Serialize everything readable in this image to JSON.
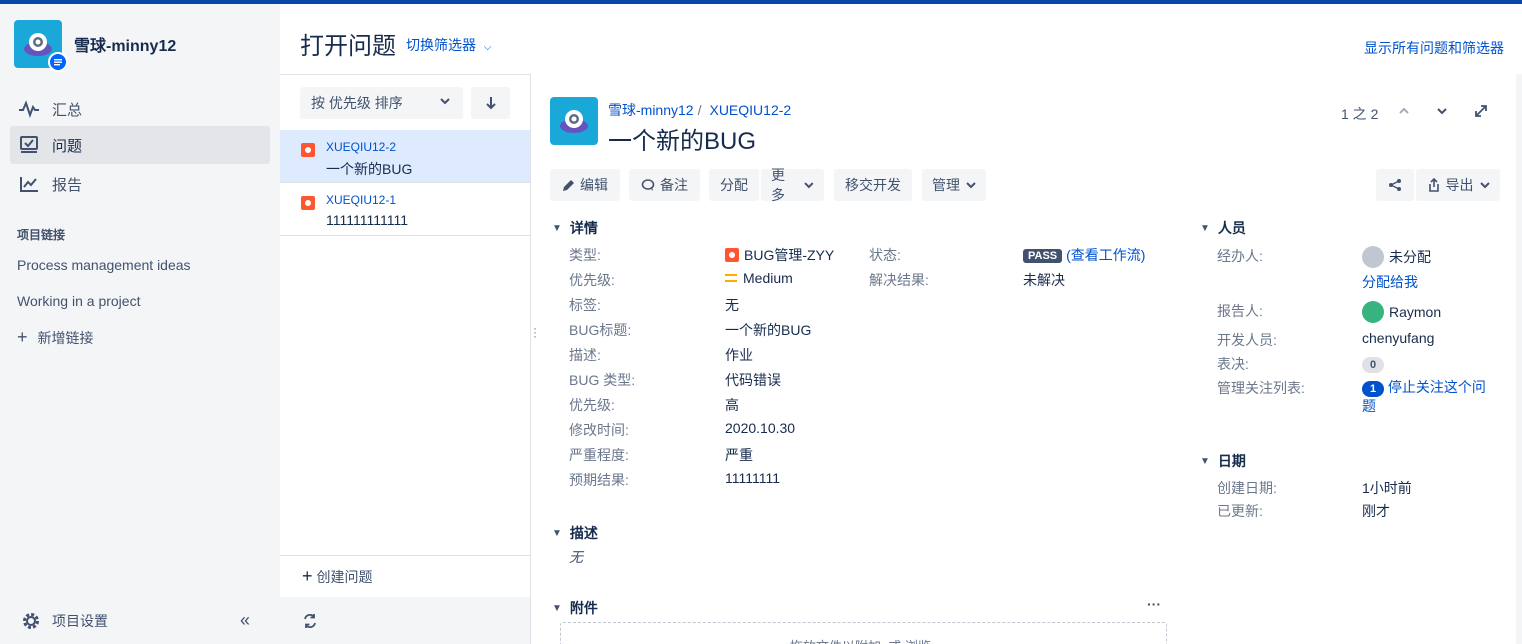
{
  "sidebar": {
    "project_name": "雪球-minny12",
    "nav": [
      {
        "label": "汇总",
        "icon": "activity-icon"
      },
      {
        "label": "问题",
        "icon": "issues-icon"
      },
      {
        "label": "报告",
        "icon": "reports-icon"
      }
    ],
    "links_title": "项目链接",
    "links": [
      "Process management ideas",
      "Working in a project"
    ],
    "add_link": "新增链接",
    "settings": "项目设置",
    "collapse": "«"
  },
  "header": {
    "title": "打开问题",
    "switch_filter": "切换筛选器",
    "show_all": "显示所有问题和筛选器"
  },
  "list": {
    "sort_label": "按 优先级 排序",
    "items": [
      {
        "key": "XUEQIU12-2",
        "summary": "一个新的BUG",
        "selected": true
      },
      {
        "key": "XUEQIU12-1",
        "summary": "111111111111",
        "selected": false
      }
    ],
    "create": "创建问题"
  },
  "issue": {
    "breadcrumb_project": "雪球-minny12",
    "breadcrumb_key": "XUEQIU12-2",
    "title": "一个新的BUG",
    "pager": "1 之 2"
  },
  "toolbar": {
    "edit": "编辑",
    "comment": "备注",
    "assign": "分配",
    "more": "更多",
    "transfer": "移交开发",
    "manage": "管理",
    "export": "导出"
  },
  "details": {
    "title": "详情",
    "fields": [
      {
        "label": "类型:",
        "value": "BUG管理-ZYY"
      },
      {
        "label": "优先级:",
        "value": "Medium"
      },
      {
        "label": "标签:",
        "value": "无"
      },
      {
        "label": "BUG标题:",
        "value": "一个新的BUG"
      },
      {
        "label": "描述:",
        "value": "作业"
      },
      {
        "label": "BUG 类型:",
        "value": "代码错误"
      },
      {
        "label": "优先级:",
        "value": "高"
      },
      {
        "label": "修改时间:",
        "value": "2020.10.30"
      },
      {
        "label": "严重程度:",
        "value": "严重"
      },
      {
        "label": "预期结果:",
        "value": "11111111"
      }
    ],
    "status_label": "状态:",
    "status_value": "PASS",
    "status_link": "(查看工作流)",
    "resolution_label": "解决结果:",
    "resolution_value": "未解决"
  },
  "description": {
    "title": "描述",
    "value": "无"
  },
  "attachments": {
    "title": "附件",
    "more": "···",
    "drop_text": "拖放文件以附加, 或 浏览。"
  },
  "people": {
    "title": "人员",
    "assignee_label": "经办人:",
    "assignee_value": "未分配",
    "assign_to_me": "分配给我",
    "reporter_label": "报告人:",
    "reporter_value": "Raymon",
    "developer_label": "开发人员:",
    "developer_value": "chenyufang",
    "votes_label": "表决:",
    "votes_value": "0",
    "watchers_label": "管理关注列表:",
    "watchers_count": "1",
    "watchers_action": "停止关注这个问题"
  },
  "dates": {
    "title": "日期",
    "created_label": "创建日期:",
    "created_value": "1小时前",
    "updated_label": "已更新:",
    "updated_value": "刚才"
  },
  "colors": {
    "accent": "#0052CC",
    "topbar": "#0747A6",
    "bug": "#FF5630",
    "priority": "#FFAB00"
  }
}
